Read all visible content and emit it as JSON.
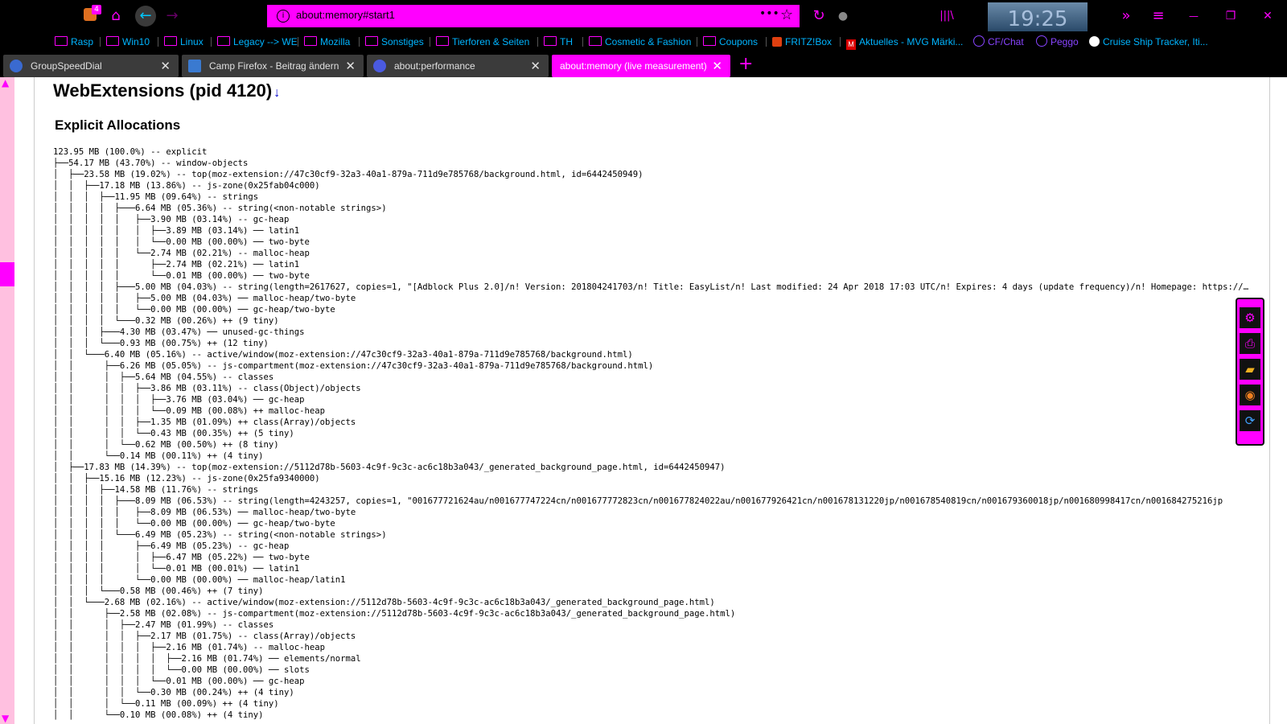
{
  "window": {
    "extension_badge": "4",
    "clock": "19:25"
  },
  "urlbar": {
    "url": "about:memory#start1",
    "more_label": "•••",
    "star_label": "☆"
  },
  "nav_icons": {
    "ext": "puzzle-icon",
    "home": "⌂",
    "back": "←",
    "forward": "→",
    "reload": "↻",
    "shield": "●",
    "library": "|||\\",
    "overflow": "»",
    "menu": "≡",
    "minimize": "—",
    "restore": "❐",
    "close": "✕"
  },
  "bookmarks": [
    {
      "label": "Rasp",
      "kind": "folder"
    },
    {
      "label": "Win10",
      "kind": "folder"
    },
    {
      "label": "Linux",
      "kind": "folder"
    },
    {
      "label": "Legacy --> WE",
      "kind": "folder"
    },
    {
      "label": "Mozilla",
      "kind": "folder"
    },
    {
      "label": "Sonstiges",
      "kind": "folder"
    },
    {
      "label": "Tierforen & Seiten",
      "kind": "folder"
    },
    {
      "label": "TH",
      "kind": "folder"
    },
    {
      "label": "Cosmetic & Fashion",
      "kind": "folder"
    },
    {
      "label": "Coupons",
      "kind": "folder"
    },
    {
      "label": "FRITZ!Box",
      "kind": "site"
    },
    {
      "label": "Aktuelles - MVG Märki...",
      "kind": "site"
    },
    {
      "label": "CF/Chat",
      "kind": "round"
    },
    {
      "label": "Peggo",
      "kind": "round"
    },
    {
      "label": "Cruise Ship Tracker, Iti...",
      "kind": "site"
    }
  ],
  "tabs": [
    {
      "label": "GroupSpeedDial",
      "close": "✕"
    },
    {
      "label": "Camp Firefox - Beitrag ändern",
      "close": "✕"
    },
    {
      "label": "about:performance",
      "close": "✕"
    },
    {
      "label": "about:memory (live measurement)",
      "close": "✕"
    }
  ],
  "new_tab_label": "+",
  "page": {
    "title": "WebExtensions (pid 4120)",
    "title_link": "↓",
    "section": "Explicit Allocations",
    "tree": [
      "123.95 MB (100.0%) -- explicit",
      "├──54.17 MB (43.70%) -- window-objects",
      "│  ├──23.58 MB (19.02%) -- top(moz-extension://47c30cf9-32a3-40a1-879a-711d9e785768/background.html, id=6442450949)",
      "│  │  ├──17.18 MB (13.86%) -- js-zone(0x25fab04c000)",
      "│  │  │  ├──11.95 MB (09.64%) -- strings",
      "│  │  │  │  ├───6.64 MB (05.36%) -- string(<non-notable strings>)",
      "│  │  │  │  │   ├──3.90 MB (03.14%) -- gc-heap",
      "│  │  │  │  │   │  ├──3.89 MB (03.14%) ── latin1",
      "│  │  │  │  │   │  └──0.00 MB (00.00%) ── two-byte",
      "│  │  │  │  │   └──2.74 MB (02.21%) -- malloc-heap",
      "│  │  │  │  │      ├──2.74 MB (02.21%) ── latin1",
      "│  │  │  │  │      └──0.01 MB (00.00%) ── two-byte",
      "│  │  │  │  ├───5.00 MB (04.03%) -- string(length=2617627, copies=1, \"[Adblock Plus 2.0]/n! Version: 201804241703/n! Title: EasyList/n! Last modified: 24 Apr 2018 17:03 UTC/n! Expires: 4 days (update frequency)/n! Homepage: https://easylist.to/",
      "│  │  │  │  │   ├──5.00 MB (04.03%) ── malloc-heap/two-byte",
      "│  │  │  │  │   └──0.00 MB (00.00%) ── gc-heap/two-byte",
      "│  │  │  │  └───0.32 MB (00.26%) ++ (9 tiny)",
      "│  │  │  ├───4.30 MB (03.47%) ── unused-gc-things",
      "│  │  │  └───0.93 MB (00.75%) ++ (12 tiny)",
      "│  │  └───6.40 MB (05.16%) -- active/window(moz-extension://47c30cf9-32a3-40a1-879a-711d9e785768/background.html)",
      "│  │      ├──6.26 MB (05.05%) -- js-compartment(moz-extension://47c30cf9-32a3-40a1-879a-711d9e785768/background.html)",
      "│  │      │  ├──5.64 MB (04.55%) -- classes",
      "│  │      │  │  ├──3.86 MB (03.11%) -- class(Object)/objects",
      "│  │      │  │  │  ├──3.76 MB (03.04%) ── gc-heap",
      "│  │      │  │  │  └──0.09 MB (00.08%) ++ malloc-heap",
      "│  │      │  │  ├──1.35 MB (01.09%) ++ class(Array)/objects",
      "│  │      │  │  └──0.43 MB (00.35%) ++ (5 tiny)",
      "│  │      │  └──0.62 MB (00.50%) ++ (8 tiny)",
      "│  │      └──0.14 MB (00.11%) ++ (4 tiny)",
      "│  ├──17.83 MB (14.39%) -- top(moz-extension://5112d78b-5603-4c9f-9c3c-ac6c18b3a043/_generated_background_page.html, id=6442450947)",
      "│  │  ├──15.16 MB (12.23%) -- js-zone(0x25fa9340000)",
      "│  │  │  ├──14.58 MB (11.76%) -- strings",
      "│  │  │  │  ├───8.09 MB (06.53%) -- string(length=4243257, copies=1, \"001677721624au/n001677747224cn/n001677772823cn/n001677824022au/n001677926421cn/n001678131220jp/n001678540819cn/n001679360018jp/n001680998417cn/n001684275216jp",
      "│  │  │  │  │   ├──8.09 MB (06.53%) ── malloc-heap/two-byte",
      "│  │  │  │  │   └──0.00 MB (00.00%) ── gc-heap/two-byte",
      "│  │  │  │  └───6.49 MB (05.23%) -- string(<non-notable strings>)",
      "│  │  │  │      ├──6.49 MB (05.23%) -- gc-heap",
      "│  │  │  │      │  ├──6.47 MB (05.22%) ── two-byte",
      "│  │  │  │      │  └──0.01 MB (00.01%) ── latin1",
      "│  │  │  │      └──0.00 MB (00.00%) ── malloc-heap/latin1",
      "│  │  │  └───0.58 MB (00.46%) ++ (7 tiny)",
      "│  │  └───2.68 MB (02.16%) -- active/window(moz-extension://5112d78b-5603-4c9f-9c3c-ac6c18b3a043/_generated_background_page.html)",
      "│  │      ├──2.58 MB (02.08%) -- js-compartment(moz-extension://5112d78b-5603-4c9f-9c3c-ac6c18b3a043/_generated_background_page.html)",
      "│  │      │  ├──2.47 MB (01.99%) -- classes",
      "│  │      │  │  ├──2.17 MB (01.75%) -- class(Array)/objects",
      "│  │      │  │  │  ├──2.16 MB (01.74%) -- malloc-heap",
      "│  │      │  │  │  │  ├──2.16 MB (01.74%) ── elements/normal",
      "│  │      │  │  │  │  └──0.00 MB (00.00%) ── slots",
      "│  │      │  │  │  └──0.01 MB (00.00%) ── gc-heap",
      "│  │      │  │  └──0.30 MB (00.24%) ++ (4 tiny)",
      "│  │      │  └──0.11 MB (00.09%) ++ (4 tiny)",
      "│  │      └──0.10 MB (00.08%) ++ (4 tiny)"
    ]
  },
  "side_panel": [
    {
      "icon": "gear-icon",
      "glyph": "⚙"
    },
    {
      "icon": "print-icon",
      "glyph": "⎙"
    },
    {
      "icon": "folder-icon",
      "glyph": "▰"
    },
    {
      "icon": "search-icon",
      "glyph": "◉"
    },
    {
      "icon": "refresh-icon",
      "glyph": "⟳"
    }
  ],
  "colors": {
    "accent": "#ff00ff",
    "link": "#00b4ff",
    "tab_bg": "#3b3b3b",
    "chrome_bg": "#000000"
  }
}
